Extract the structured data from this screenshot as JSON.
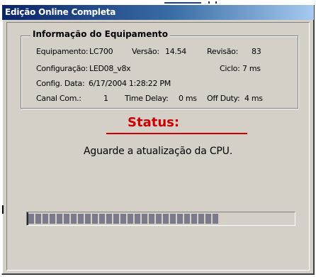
{
  "window": {
    "title": "Edição Online Completa"
  },
  "equipment_info": {
    "heading": "Informação do Equipamento",
    "equipamento_label": "Equipamento:",
    "equipamento_value": "LC700",
    "versao_label": "Versão:",
    "versao_value": "14.54",
    "revisao_label": "Revisão:",
    "revisao_value": "83",
    "configuracao_label": "Configuração:",
    "configuracao_value": "LED08_v8x",
    "ciclo_label": "Ciclo:",
    "ciclo_value": "7 ms",
    "config_data_label": "Config. Data:",
    "config_data_value": "6/17/2004 1:28:22 PM",
    "canal_com_label": "Canal Com.:",
    "canal_com_value": "1",
    "time_delay_label": "Time Delay:",
    "time_delay_value": "0 ms",
    "off_duty_label": "Off Duty:",
    "off_duty_value": "4 ms"
  },
  "status": {
    "heading": "Status:",
    "message": "Aguarde a atualização da CPU."
  },
  "progress": {
    "fraction": 0.72
  },
  "colors": {
    "title_gradient_start": "#0a246a",
    "title_gradient_end": "#a6caf0",
    "status_red": "#cc0000",
    "progress_block": "#7a7a8c",
    "dialog_face": "#d4d0c8"
  }
}
